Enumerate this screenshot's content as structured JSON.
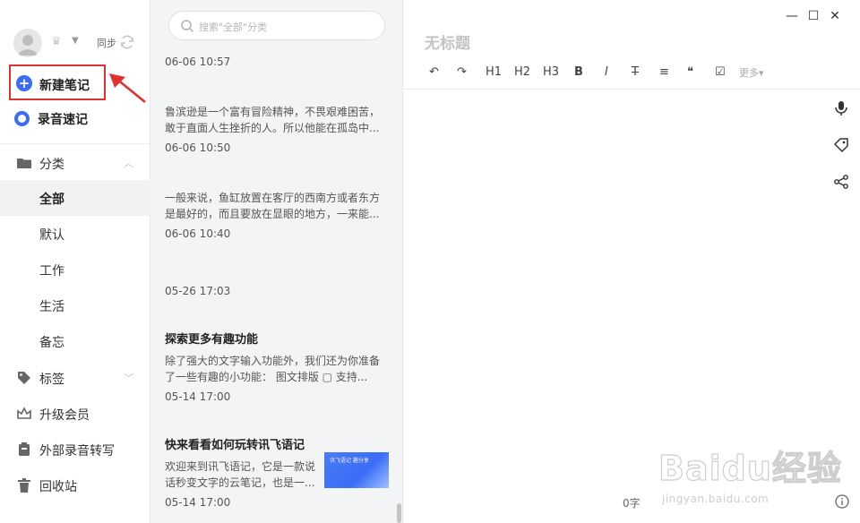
{
  "sidebar": {
    "sync_label": "同步",
    "new_note_label": "新建笔记",
    "record_label": "录音速记",
    "categories_label": "分类",
    "category_items": [
      "全部",
      "默认",
      "工作",
      "生活",
      "备忘"
    ],
    "tags_label": "标签",
    "upgrade_label": "升级会员",
    "transcribe_label": "外部录音转写",
    "trash_label": "回收站",
    "accent": "#3a6cf6",
    "highlight": "#e03131"
  },
  "list": {
    "search_placeholder": "搜索\"全部\"分类",
    "notes": [
      {
        "title": "",
        "snippet": "",
        "date": "06-06 10:57"
      },
      {
        "title": "",
        "snippet": "鲁滨逊是一个富有冒险精神，不畏艰难困苦，敢于直面人生挫折的人。所以他能在孤岛中...",
        "date": "06-06 10:50"
      },
      {
        "title": "",
        "snippet": "一般来说，鱼缸放置在客厅的西南方或者东方是最好的，而且要放在显眼的地方，一来能...",
        "date": "06-06 10:40"
      },
      {
        "title": "",
        "snippet": "",
        "date": "05-26 17:03"
      },
      {
        "title": "探索更多有趣功能",
        "snippet": "除了强大的文字输入功能外，我们还为你准备了一些有趣的小功能：  图文排版 ▢ 支持...",
        "date": "05-14 17:00"
      },
      {
        "title": "快来看看如何玩转讯飞语记",
        "snippet": "欢迎来到讯飞语记，它是一款说话秒变文字的云笔记，也是一...",
        "date": "05-14 17:00",
        "thumb_text": "讯飞语记 趣分享"
      }
    ]
  },
  "editor": {
    "title_placeholder": "无标题",
    "more_label": "更多",
    "word_count": "0字",
    "toolbar": [
      "↶",
      "↷",
      "H1",
      "H2",
      "H3",
      "B",
      "I",
      "T",
      "≡",
      "❝",
      "☑"
    ]
  },
  "watermark": {
    "brand": "Baidu经验",
    "url": "jingyan.baidu.com"
  }
}
